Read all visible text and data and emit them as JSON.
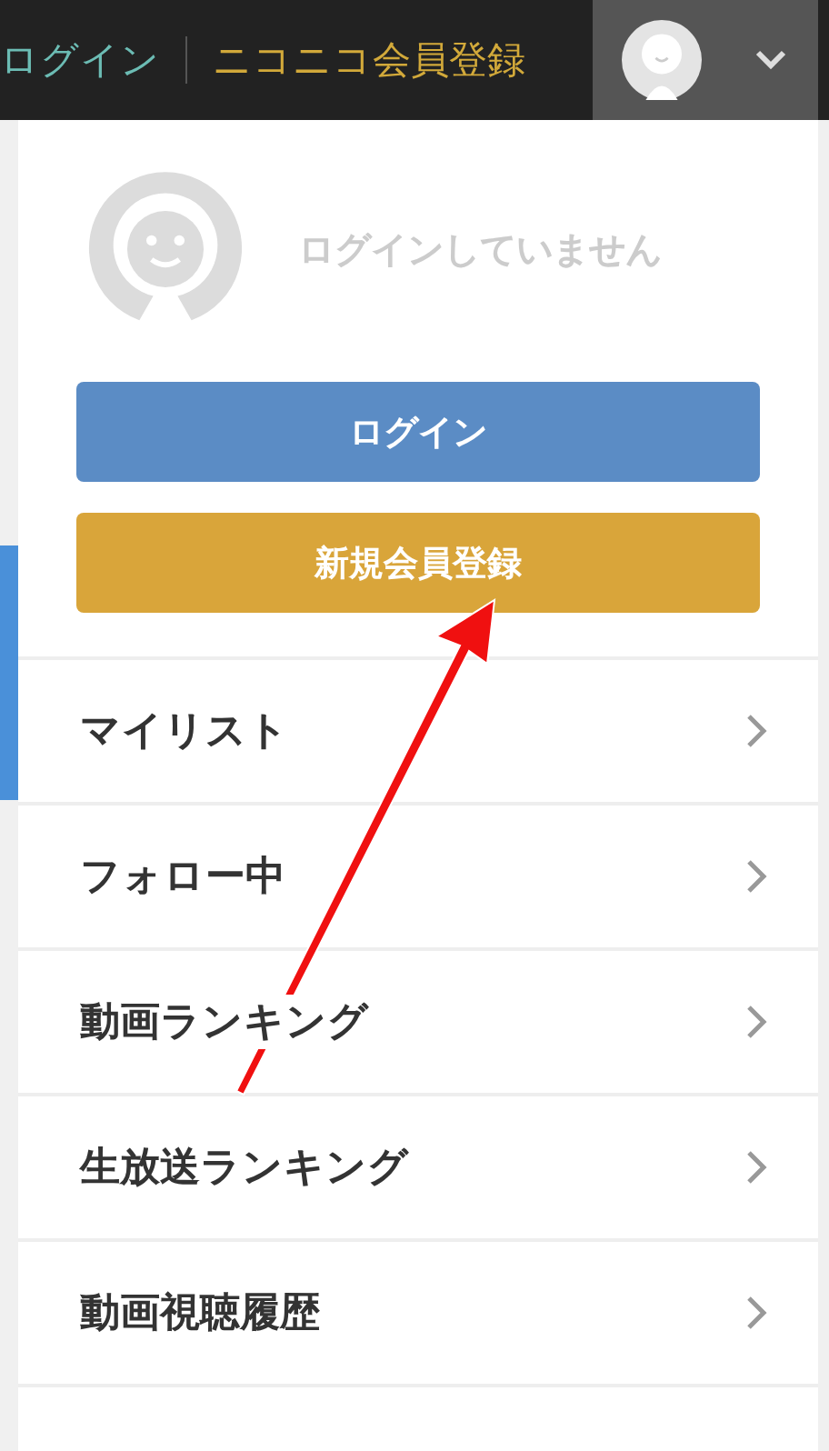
{
  "header": {
    "login_link": "ログイン",
    "register_link": "ニコニコ会員登録"
  },
  "panel": {
    "status_text": "ログインしていません",
    "buttons": [
      {
        "label": "ログイン",
        "kind": "login"
      },
      {
        "label": "新規会員登録",
        "kind": "register"
      }
    ],
    "menu": [
      {
        "label": "マイリスト"
      },
      {
        "label": "フォロー中"
      },
      {
        "label": "動画ランキング"
      },
      {
        "label": "生放送ランキング"
      },
      {
        "label": "動画視聴履歴"
      }
    ]
  }
}
